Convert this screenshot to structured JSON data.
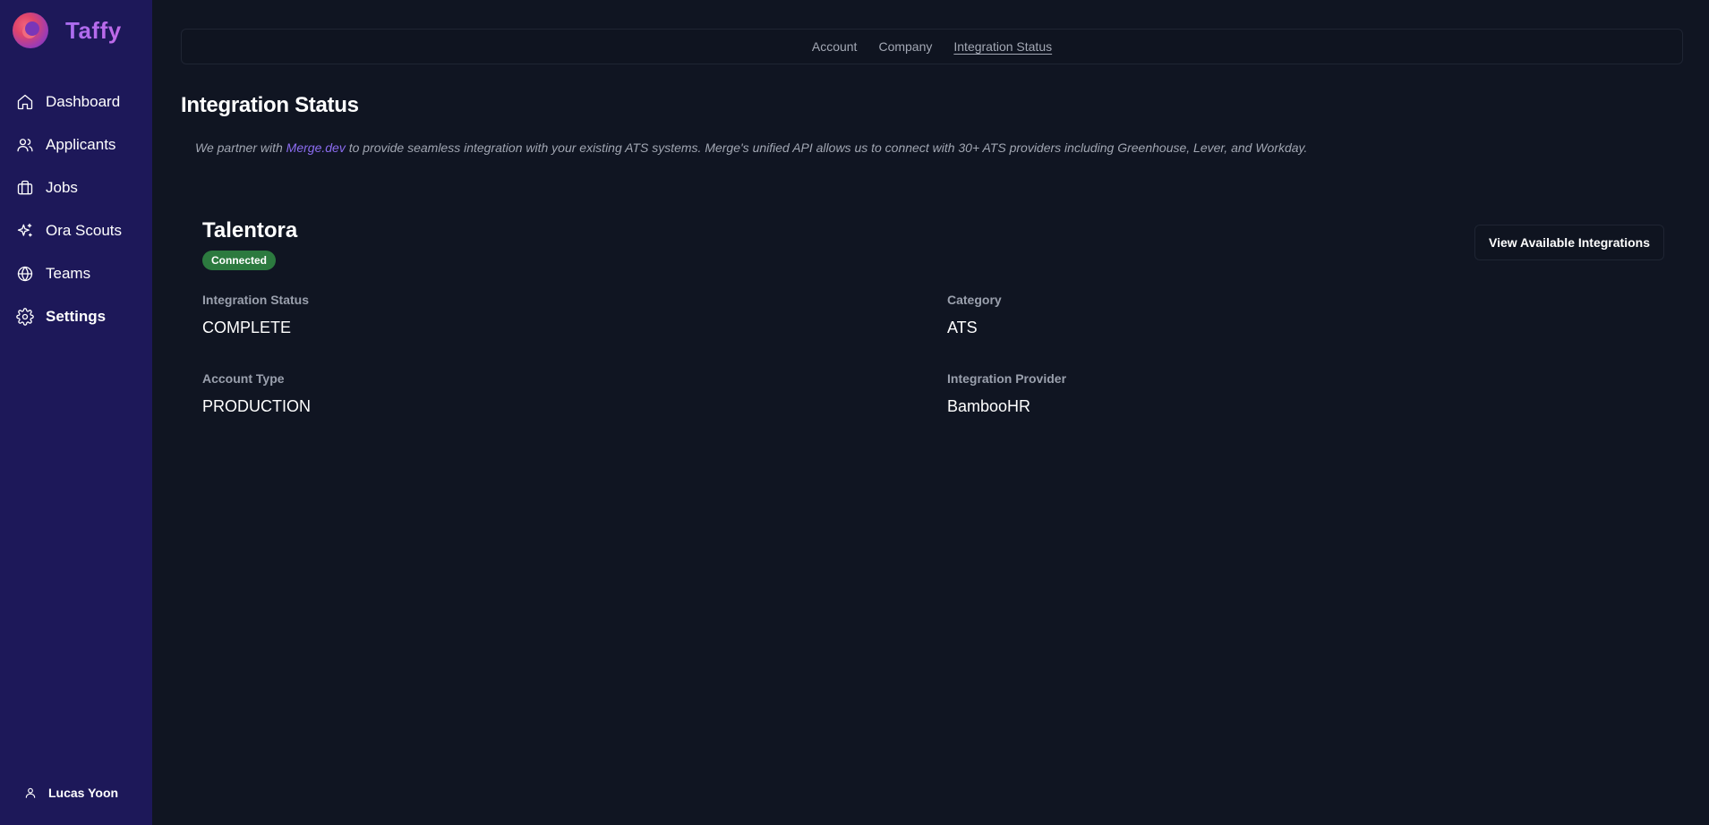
{
  "brand": {
    "name": "Taffy"
  },
  "sidebar": {
    "items": [
      {
        "label": "Dashboard",
        "icon": "home-icon"
      },
      {
        "label": "Applicants",
        "icon": "users-icon"
      },
      {
        "label": "Jobs",
        "icon": "briefcase-icon"
      },
      {
        "label": "Ora Scouts",
        "icon": "sparkles-icon"
      },
      {
        "label": "Teams",
        "icon": "globe-icon"
      },
      {
        "label": "Settings",
        "icon": "gear-icon",
        "active": true
      }
    ],
    "user": {
      "name": "Lucas Yoon",
      "icon": "user-icon"
    }
  },
  "topnav": {
    "items": [
      "Account",
      "Company",
      "Integration Status"
    ],
    "current": "Integration Status"
  },
  "page": {
    "title": "Integration Status",
    "intro_before": "We partner with ",
    "intro_link": "Merge.dev",
    "intro_after": " to provide seamless integration with your existing ATS systems. Merge's unified API allows us to connect with 30+ ATS providers including Greenhouse, Lever, and Workday."
  },
  "integration": {
    "name": "Talentora",
    "status_badge": "Connected",
    "view_button": "View Available Integrations",
    "fields": [
      {
        "label": "Integration Status",
        "value": "COMPLETE"
      },
      {
        "label": "Category",
        "value": "ATS"
      },
      {
        "label": "Account Type",
        "value": "PRODUCTION"
      },
      {
        "label": "Integration Provider",
        "value": "BambooHR"
      }
    ]
  },
  "colors": {
    "sidebar_bg": "#1d1859",
    "main_bg": "#101522",
    "accent": "#8b6cf0",
    "badge_green": "#2c7a3f"
  }
}
